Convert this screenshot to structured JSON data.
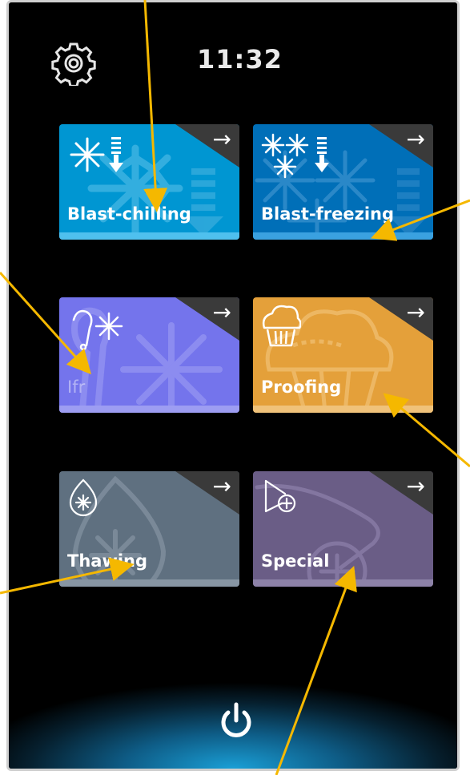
{
  "status": {
    "time": "11:32"
  },
  "tiles": [
    {
      "id": "blast-chilling",
      "label": "Blast-chilling",
      "arrow": "→"
    },
    {
      "id": "blast-freezing",
      "label": "Blast-freezing",
      "arrow": "→"
    },
    {
      "id": "ifr",
      "label": "Ifr",
      "arrow": "→"
    },
    {
      "id": "proofing",
      "label": "Proofing",
      "arrow": "→"
    },
    {
      "id": "thawing",
      "label": "Thawing",
      "arrow": "→"
    },
    {
      "id": "special",
      "label": "Special",
      "arrow": "→"
    }
  ],
  "icons": {
    "settings": "gear-icon",
    "power": "power-icon"
  },
  "colors": {
    "blast_chilling": "#0096d2",
    "blast_freezing": "#006fb8",
    "ifr": "#7474ec",
    "proofing": "#e4a03a",
    "thawing": "#5f7080",
    "special": "#6a5d86",
    "callout": "#f5b800"
  }
}
